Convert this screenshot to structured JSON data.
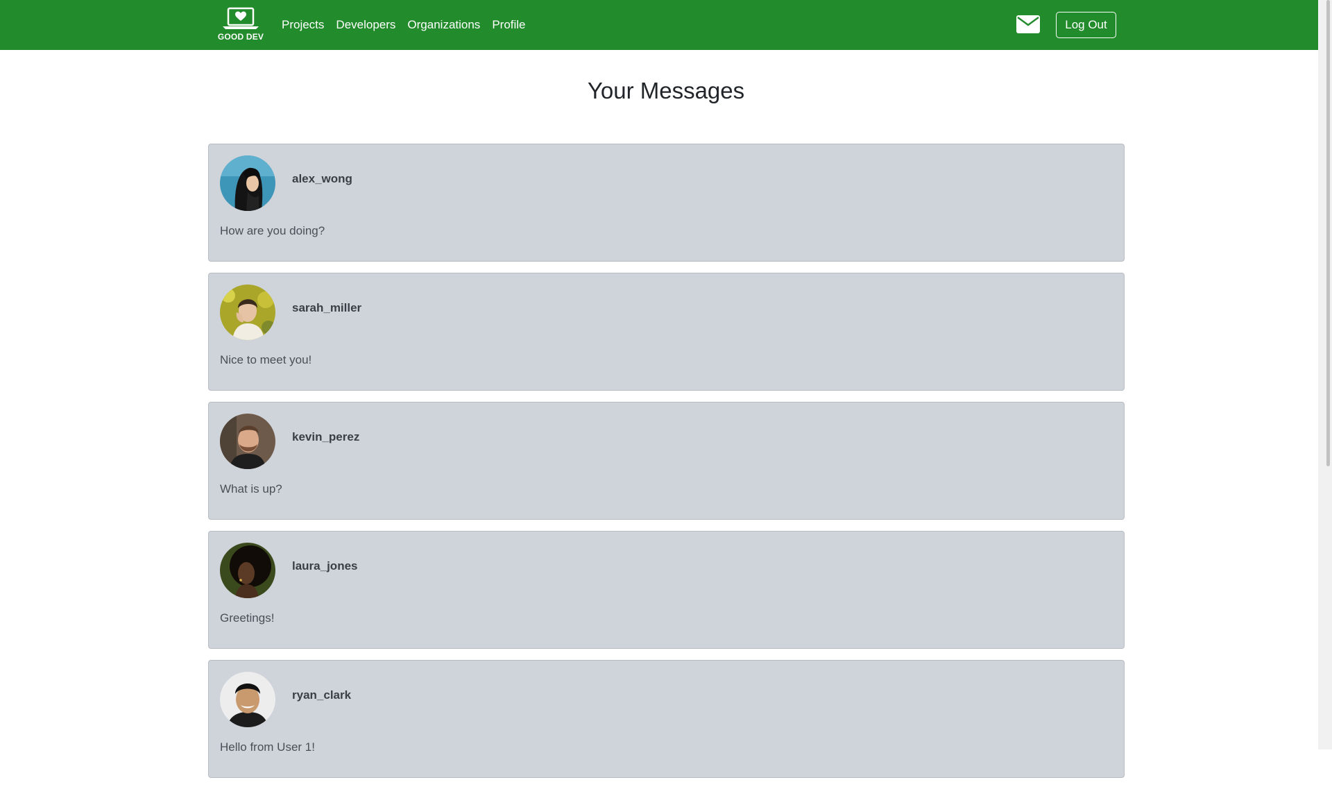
{
  "brand": {
    "name": "GOOD DEV"
  },
  "nav": {
    "links": [
      "Projects",
      "Developers",
      "Organizations",
      "Profile"
    ],
    "logout_label": "Log Out"
  },
  "colors": {
    "navbar": "#228b2b",
    "card_background": "#cfd3da"
  },
  "page": {
    "title": "Your Messages"
  },
  "messages": [
    {
      "username": "alex_wong",
      "text": "How are you doing?"
    },
    {
      "username": "sarah_miller",
      "text": "Nice to meet you!"
    },
    {
      "username": "kevin_perez",
      "text": "What is up?"
    },
    {
      "username": "laura_jones",
      "text": "Greetings!"
    },
    {
      "username": "ryan_clark",
      "text": "Hello from User 1!"
    }
  ]
}
